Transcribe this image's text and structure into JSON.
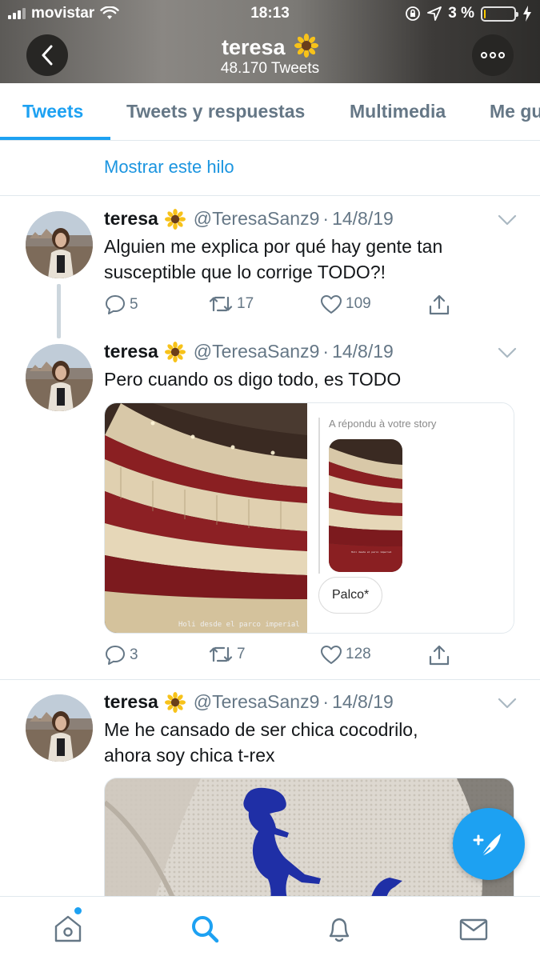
{
  "status_bar": {
    "carrier": "movistar",
    "time": "18:13",
    "battery_percent": "3 %",
    "battery_level": 0.05
  },
  "profile_header": {
    "name": "teresa",
    "tweet_count": "48.170 Tweets"
  },
  "tabs": [
    {
      "label": "Tweets",
      "active": true
    },
    {
      "label": "Tweets y respuestas",
      "active": false
    },
    {
      "label": "Multimedia",
      "active": false
    },
    {
      "label": "Me gusta",
      "active": false
    }
  ],
  "show_thread": "Mostrar este hilo",
  "tweets": [
    {
      "name": "teresa",
      "emoji": "sunflower-icon",
      "handle": "@TeresaSanz9",
      "date": "14/8/19",
      "text": "Alguien me explica por qué hay gente tan susceptible que lo corrige TODO?!",
      "replies": "5",
      "retweets": "17",
      "likes": "109"
    },
    {
      "name": "teresa",
      "emoji": "sunflower-icon",
      "handle": "@TeresaSanz9",
      "date": "14/8/19",
      "text": "Pero cuando os digo todo, es TODO",
      "replies": "3",
      "retweets": "7",
      "likes": "128",
      "media": {
        "left_caption": "Holi desde el parco imperial",
        "story_label": "A répondu à votre story",
        "thumb_caption": "Holi desde el parco imperial",
        "reply_bubble": "Palco*"
      }
    },
    {
      "name": "teresa",
      "emoji": "sunflower-icon",
      "handle": "@TeresaSanz9",
      "date": "14/8/19",
      "text_line1": "Me he cansado de ser chica cocodrilo,",
      "text_line2": "ahora soy chica t-rex"
    }
  ],
  "colors": {
    "accent": "#1da1f2",
    "link": "#1b95e0",
    "muted": "#657786",
    "text": "#14171a",
    "border": "#e1e8ed"
  },
  "icons": {
    "back": "chevron-left-icon",
    "more": "more-horizontal-icon",
    "reply": "reply-bubble-icon",
    "retweet": "retweet-icon",
    "like": "heart-icon",
    "share": "share-icon",
    "compose": "compose-feather-icon",
    "nav": [
      "home-icon",
      "search-icon",
      "notifications-bell-icon",
      "messages-envelope-icon"
    ]
  }
}
